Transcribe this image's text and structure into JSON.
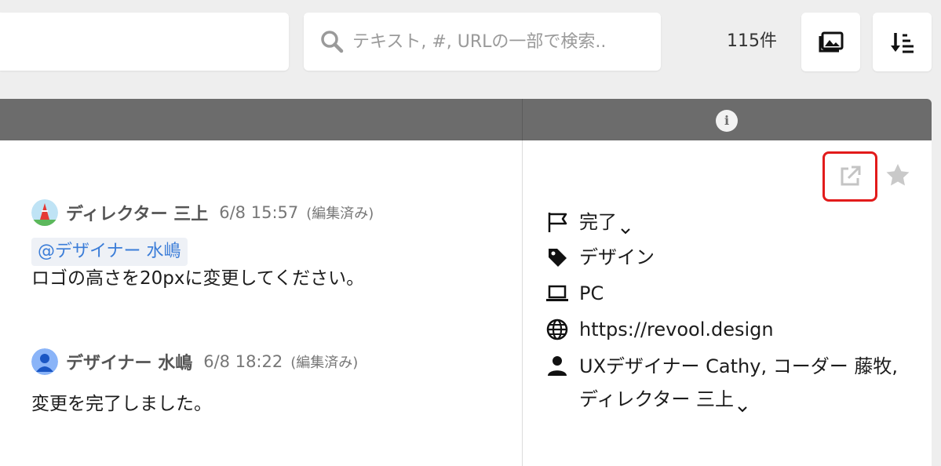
{
  "toolbar": {
    "search_placeholder": "テキスト, #, URLの一部で検索..",
    "count": "115件",
    "image_button_icon": "image-icon",
    "sort_button_icon": "sort-icon"
  },
  "panel": {
    "header_icon": "info-icon"
  },
  "comments": [
    {
      "author": "ディレクター 三上",
      "time": "6/8 15:57",
      "edited": "(編集済み)",
      "mention": "@デザイナー 水嶋",
      "text": "ロゴの高さを20pxに変更してください。"
    },
    {
      "author": "デザイナー 水嶋",
      "time": "6/8 18:22",
      "edited": "(編集済み)",
      "text": "変更を完了しました。"
    }
  ],
  "detail": {
    "status": "完了",
    "tag": "デザイン",
    "device": "PC",
    "url": "https://revool.design",
    "members": "UXデザイナー Cathy, コーダー 藤牧, ディレクター 三上"
  },
  "colors": {
    "header_bg": "#6c6c6c",
    "mention_text": "#3b7dd8",
    "highlight_border": "#e21b1b",
    "star": "#c9c9c9"
  }
}
